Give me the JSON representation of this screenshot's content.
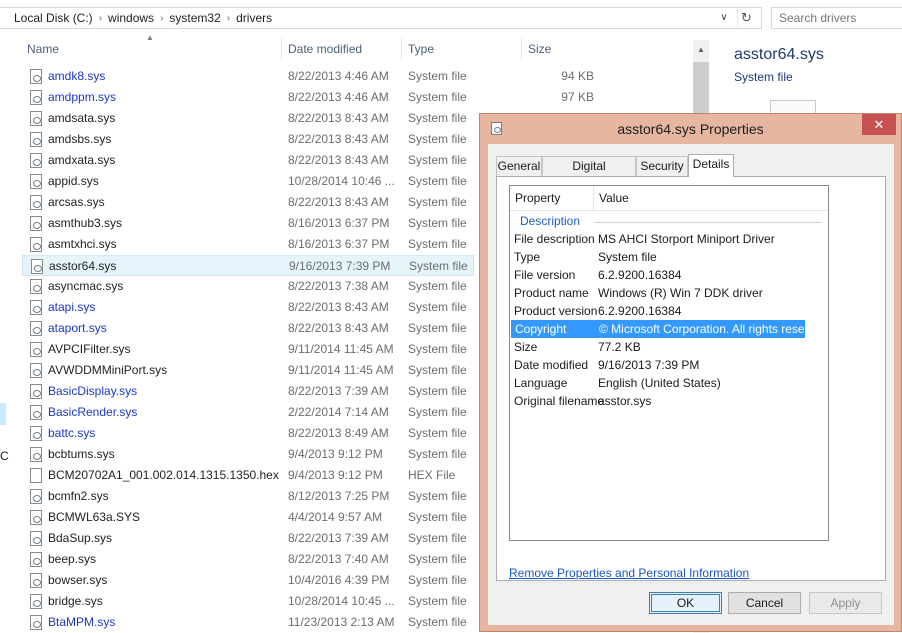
{
  "address": {
    "crumbs": [
      "Local Disk (C:)",
      "windows",
      "system32",
      "drivers"
    ],
    "search_placeholder": "Search drivers"
  },
  "columns": {
    "name": "Name",
    "date": "Date modified",
    "type": "Type",
    "size": "Size"
  },
  "files": [
    {
      "name": "amdk8.sys",
      "date": "8/22/2013 4:46 AM",
      "type": "System file",
      "size": "94 KB",
      "blue": true
    },
    {
      "name": "amdppm.sys",
      "date": "8/22/2013 4:46 AM",
      "type": "System file",
      "size": "97 KB",
      "blue": true
    },
    {
      "name": "amdsata.sys",
      "date": "8/22/2013 8:43 AM",
      "type": "System file",
      "size": "",
      "blue": false
    },
    {
      "name": "amdsbs.sys",
      "date": "8/22/2013 8:43 AM",
      "type": "System file",
      "size": "",
      "blue": false
    },
    {
      "name": "amdxata.sys",
      "date": "8/22/2013 8:43 AM",
      "type": "System file",
      "size": "",
      "blue": false
    },
    {
      "name": "appid.sys",
      "date": "10/28/2014 10:46 ...",
      "type": "System file",
      "size": "",
      "blue": false
    },
    {
      "name": "arcsas.sys",
      "date": "8/22/2013 8:43 AM",
      "type": "System file",
      "size": "",
      "blue": false
    },
    {
      "name": "asmthub3.sys",
      "date": "8/16/2013 6:37 PM",
      "type": "System file",
      "size": "",
      "blue": false
    },
    {
      "name": "asmtxhci.sys",
      "date": "8/16/2013 6:37 PM",
      "type": "System file",
      "size": "",
      "blue": false
    },
    {
      "name": "asstor64.sys",
      "date": "9/16/2013 7:39 PM",
      "type": "System file",
      "size": "",
      "blue": false,
      "selected": true
    },
    {
      "name": "asyncmac.sys",
      "date": "8/22/2013 7:38 AM",
      "type": "System file",
      "size": "",
      "blue": false
    },
    {
      "name": "atapi.sys",
      "date": "8/22/2013 8:43 AM",
      "type": "System file",
      "size": "",
      "blue": true
    },
    {
      "name": "ataport.sys",
      "date": "8/22/2013 8:43 AM",
      "type": "System file",
      "size": "",
      "blue": true
    },
    {
      "name": "AVPCIFilter.sys",
      "date": "9/11/2014 11:45 AM",
      "type": "System file",
      "size": "",
      "blue": false
    },
    {
      "name": "AVWDDMMiniPort.sys",
      "date": "9/11/2014 11:45 AM",
      "type": "System file",
      "size": "",
      "blue": false
    },
    {
      "name": "BasicDisplay.sys",
      "date": "8/22/2013 7:39 AM",
      "type": "System file",
      "size": "",
      "blue": true
    },
    {
      "name": "BasicRender.sys",
      "date": "2/22/2014 7:14 AM",
      "type": "System file",
      "size": "",
      "blue": true
    },
    {
      "name": "battc.sys",
      "date": "8/22/2013 8:49 AM",
      "type": "System file",
      "size": "",
      "blue": true
    },
    {
      "name": "bcbtums.sys",
      "date": "9/4/2013 9:12 PM",
      "type": "System file",
      "size": "",
      "blue": false
    },
    {
      "name": "BCM20702A1_001.002.014.1315.1350.hex",
      "date": "9/4/2013 9:12 PM",
      "type": "HEX File",
      "size": "",
      "blue": false,
      "hex": true
    },
    {
      "name": "bcmfn2.sys",
      "date": "8/12/2013 7:25 PM",
      "type": "System file",
      "size": "",
      "blue": false
    },
    {
      "name": "BCMWL63a.SYS",
      "date": "4/4/2014 9:57 AM",
      "type": "System file",
      "size": "",
      "blue": false
    },
    {
      "name": "BdaSup.sys",
      "date": "8/22/2013 7:39 AM",
      "type": "System file",
      "size": "",
      "blue": false
    },
    {
      "name": "beep.sys",
      "date": "8/22/2013 7:40 AM",
      "type": "System file",
      "size": "",
      "blue": false
    },
    {
      "name": "bowser.sys",
      "date": "10/4/2016 4:39 PM",
      "type": "System file",
      "size": "",
      "blue": false
    },
    {
      "name": "bridge.sys",
      "date": "10/28/2014 10:45 ...",
      "type": "System file",
      "size": "",
      "blue": false
    },
    {
      "name": "BtaMPM.sys",
      "date": "11/23/2013 2:13 AM",
      "type": "System file",
      "size": "",
      "blue": true
    }
  ],
  "nav": {
    "letter": "C"
  },
  "preview": {
    "name": "asstor64.sys",
    "type": "System file"
  },
  "dialog": {
    "title": "asstor64.sys Properties",
    "close_glyph": "✕",
    "tabs": [
      "General",
      "Digital Signatures",
      "Security",
      "Details"
    ],
    "active_tab": "Details",
    "grid_headers": {
      "property": "Property",
      "value": "Value"
    },
    "section": "Description",
    "properties": [
      {
        "prop": "File description",
        "val": "MS AHCI Storport Miniport Driver"
      },
      {
        "prop": "Type",
        "val": "System file"
      },
      {
        "prop": "File version",
        "val": "6.2.9200.16384"
      },
      {
        "prop": "Product name",
        "val": "Windows (R) Win 7 DDK driver"
      },
      {
        "prop": "Product version",
        "val": "6.2.9200.16384"
      },
      {
        "prop": "Copyright",
        "val": "© Microsoft Corporation. All rights reserv...",
        "selected": true
      },
      {
        "prop": "Size",
        "val": "77.2 KB"
      },
      {
        "prop": "Date modified",
        "val": "9/16/2013 7:39 PM"
      },
      {
        "prop": "Language",
        "val": "English (United States)"
      },
      {
        "prop": "Original filename",
        "val": "asstor.sys"
      }
    ],
    "remove_link": "Remove Properties and Personal Information",
    "buttons": {
      "ok": "OK",
      "cancel": "Cancel",
      "apply": "Apply"
    }
  },
  "colors": {
    "accent": "#3399ff",
    "link": "#1a57c4",
    "close": "#c75050",
    "dialog_frame": "#e7b6a1"
  }
}
